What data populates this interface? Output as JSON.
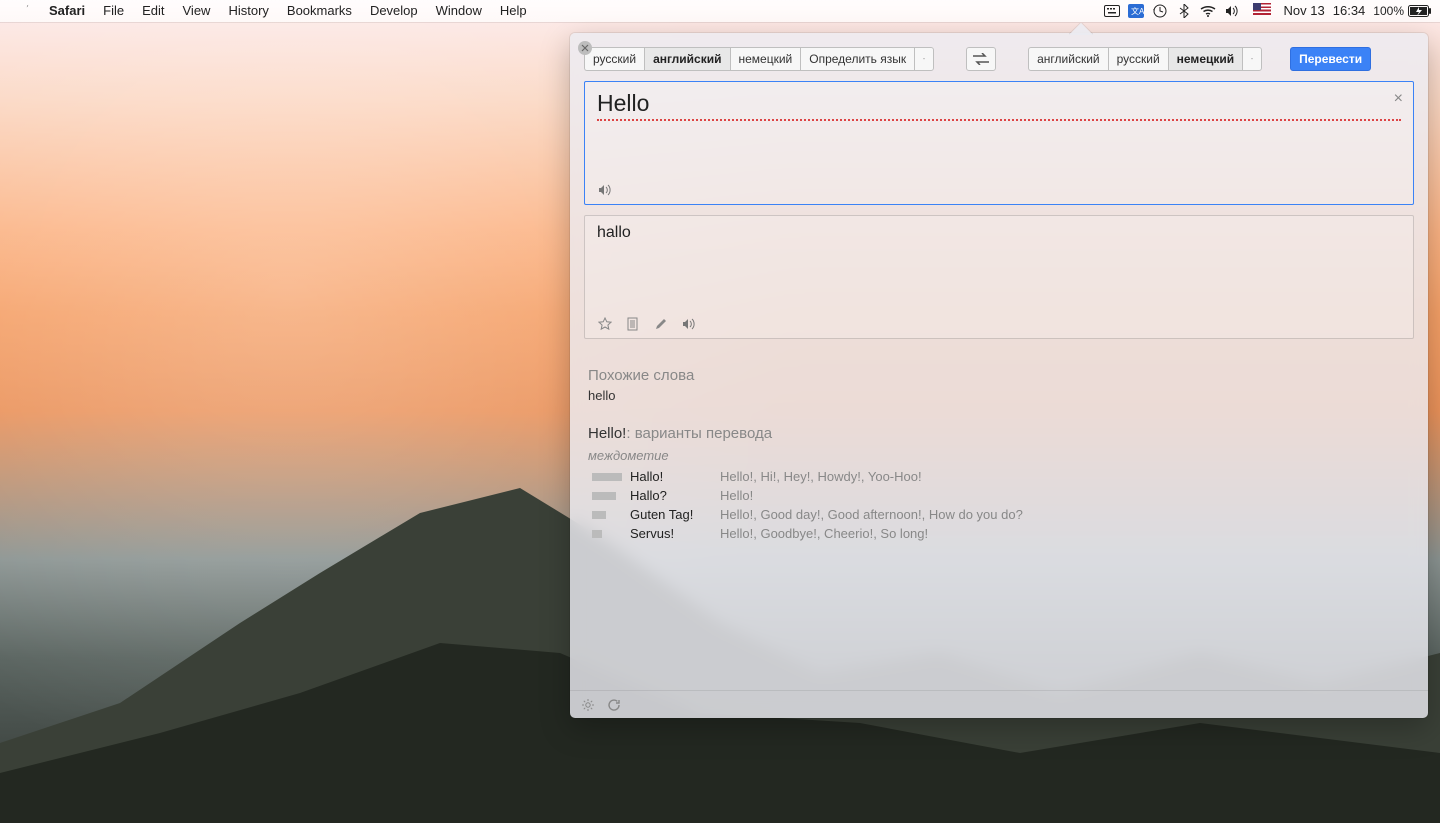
{
  "menubar": {
    "app": "Safari",
    "items": [
      "File",
      "Edit",
      "View",
      "History",
      "Bookmarks",
      "Develop",
      "Window",
      "Help"
    ],
    "date": "Nov 13",
    "time": "16:34",
    "battery": "100%"
  },
  "toolbar": {
    "src_langs": [
      "русский",
      "английский",
      "немецкий"
    ],
    "src_selected_index": 1,
    "src_detect": "Определить язык",
    "dst_langs": [
      "английский",
      "русский",
      "немецкий"
    ],
    "dst_selected_index": 2,
    "translate_btn": "Перевести"
  },
  "input": {
    "text": "Hello",
    "clear_char": "×"
  },
  "output": {
    "text": "hallo"
  },
  "similar": {
    "title": "Похожие слова",
    "word": "hello"
  },
  "variants": {
    "headword": "Hello!",
    "subtitle": ": варианты перевода",
    "pos": "междометие",
    "rows": [
      {
        "freq": 30,
        "term": "Hallo!",
        "syn": "Hello!, Hi!, Hey!, Howdy!, Yoo-Hoo!"
      },
      {
        "freq": 24,
        "term": "Hallo?",
        "syn": "Hello!"
      },
      {
        "freq": 14,
        "term": "Guten Tag!",
        "syn": "Hello!, Good day!, Good afternoon!, How do you do?"
      },
      {
        "freq": 10,
        "term": "Servus!",
        "syn": "Hello!, Goodbye!, Cheerio!, So long!"
      }
    ]
  }
}
